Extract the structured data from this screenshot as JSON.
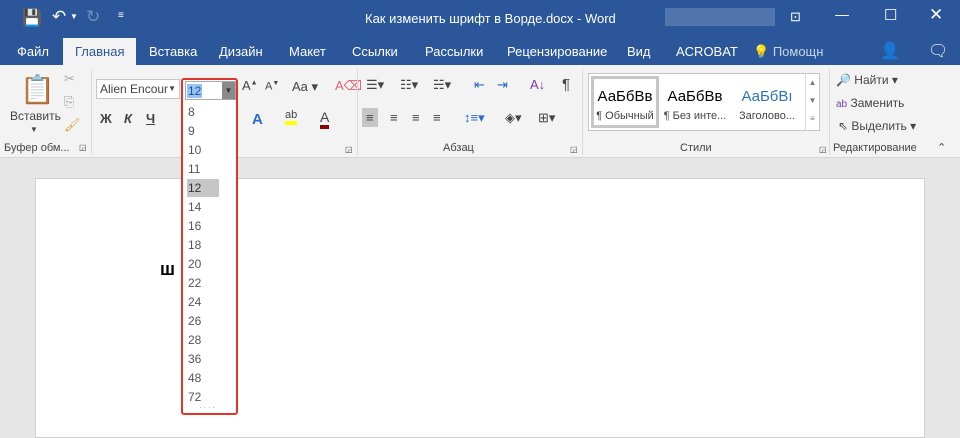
{
  "title": "Как изменить шрифт в Ворде.docx - Word",
  "tabs": [
    "Файл",
    "Главная",
    "Вставка",
    "Дизайн",
    "Макет",
    "Ссылки",
    "Рассылки",
    "Рецензирование",
    "Вид",
    "ACROBAT"
  ],
  "help": "Помощн",
  "font_name": "Alien Encour",
  "font_size": "12",
  "sizes": [
    "8",
    "9",
    "10",
    "11",
    "12",
    "14",
    "16",
    "18",
    "20",
    "22",
    "24",
    "26",
    "28",
    "36",
    "48",
    "72"
  ],
  "selected_size": "12",
  "paste_label": "Вставить",
  "groups": {
    "clipboard": "Буфер обм...",
    "paragraph": "Абзац",
    "styles": "Стили",
    "editing": "Редактирование"
  },
  "format": {
    "bold": "Ж",
    "italic": "К",
    "underline": "Ч"
  },
  "styles": [
    {
      "preview": "АаБбВв",
      "name": "¶ Обычный"
    },
    {
      "preview": "АаБбВв",
      "name": "¶ Без инте..."
    },
    {
      "preview": "АаБбВı",
      "name": "Заголово..."
    }
  ],
  "editing": {
    "find": "Найти",
    "replace": "Заменить",
    "select": "Выделить"
  },
  "doc_text": "ш",
  "colors": {
    "brand": "#2b579a",
    "highlight": "#e0352b"
  }
}
